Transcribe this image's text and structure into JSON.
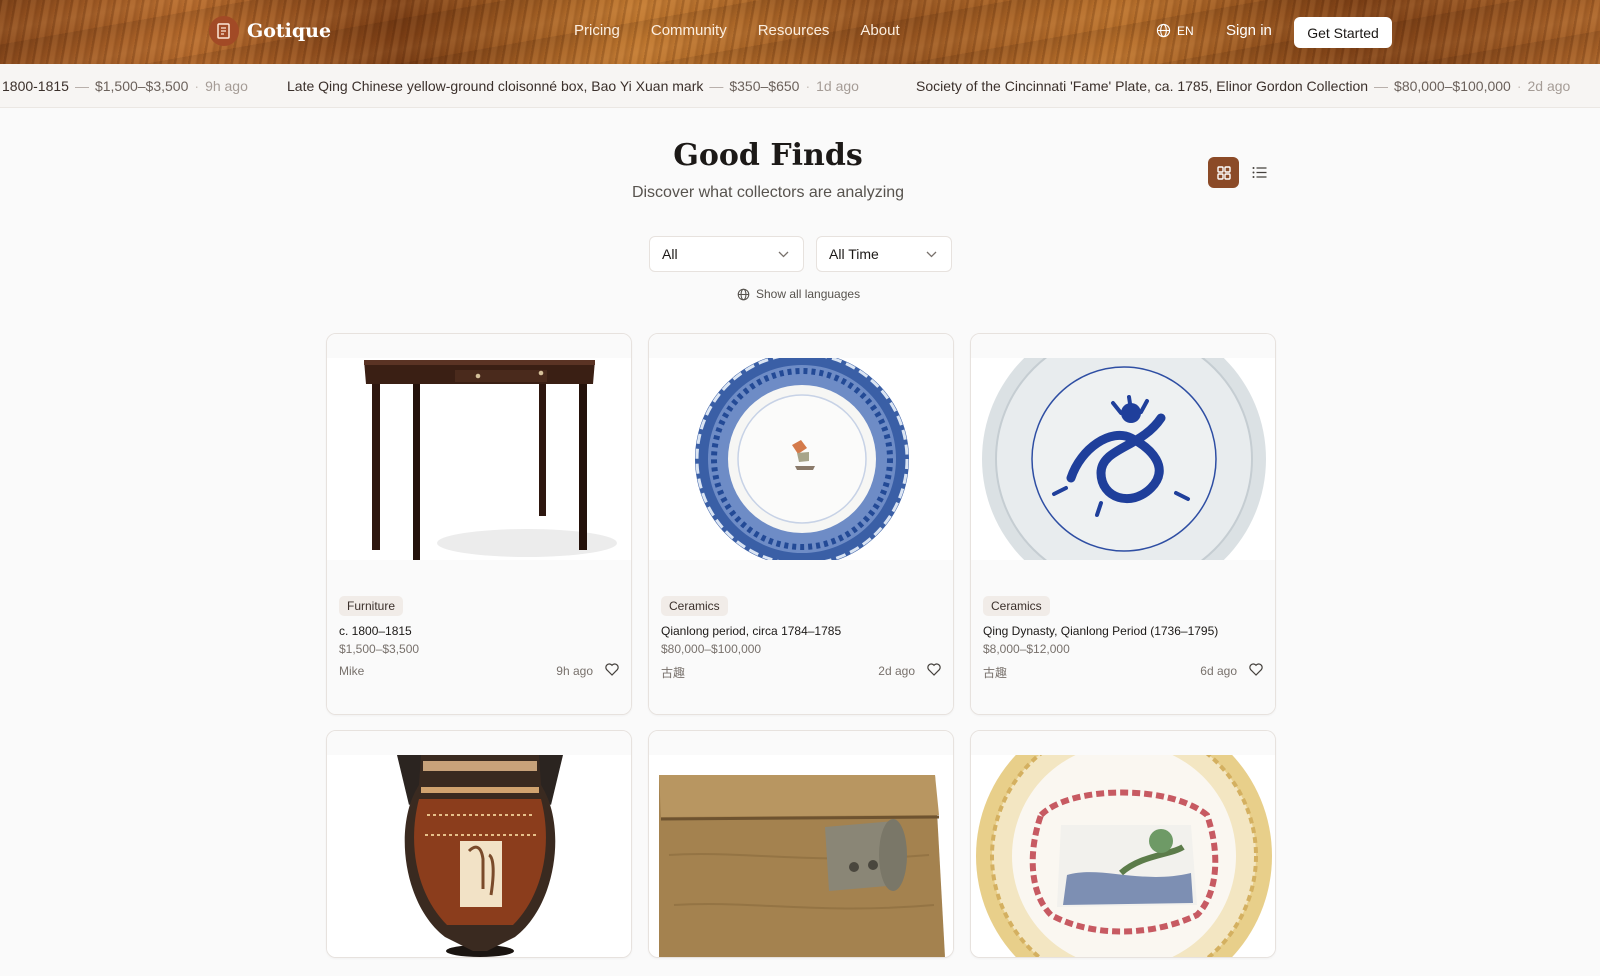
{
  "header": {
    "brand": "Gotique",
    "nav": [
      "Pricing",
      "Community",
      "Resources",
      "About"
    ],
    "lang": "EN",
    "sign_in": "Sign in",
    "cta": "Get Started"
  },
  "ticker": [
    {
      "title": "1800-1815",
      "price": "$1,500–$3,500",
      "time": "9h ago"
    },
    {
      "title": "Late Qing Chinese yellow-ground cloisonné box, Bao Yi Xuan mark",
      "price": "$350–$650",
      "time": "1d ago"
    },
    {
      "title": "Society of the Cincinnati 'Fame' Plate, ca. 1785, Elinor Gordon Collection",
      "price": "$80,000–$100,000",
      "time": "2d ago"
    }
  ],
  "page": {
    "title": "Good Finds",
    "subtitle": "Discover what collectors are analyzing"
  },
  "filters": {
    "category": "All",
    "time": "All Time",
    "show_languages": "Show all languages"
  },
  "cards": [
    {
      "category": "Furniture",
      "title": "c. 1800–1815",
      "price": "$1,500–$3,500",
      "user": "Mike",
      "time": "9h ago",
      "image": "mahogany-side-table"
    },
    {
      "category": "Ceramics",
      "title": "Qianlong period, circa 1784–1785",
      "price": "$80,000–$100,000",
      "user": "古趣",
      "time": "2d ago",
      "image": "blue-white-plate"
    },
    {
      "category": "Ceramics",
      "title": "Qing Dynasty, Qianlong Period (1736–1795)",
      "price": "$8,000–$12,000",
      "user": "古趣",
      "time": "6d ago",
      "image": "dragon-dish"
    },
    {
      "image": "greek-krater-vase"
    },
    {
      "image": "wooden-box"
    },
    {
      "image": "famille-rose-plate"
    }
  ],
  "colors": {
    "accent": "#8b4a27",
    "header_wood": "#9a5522"
  },
  "icons": [
    "logo-icon",
    "globe-icon",
    "grid-view-icon",
    "list-view-icon",
    "chevron-down-icon",
    "heart-icon"
  ]
}
